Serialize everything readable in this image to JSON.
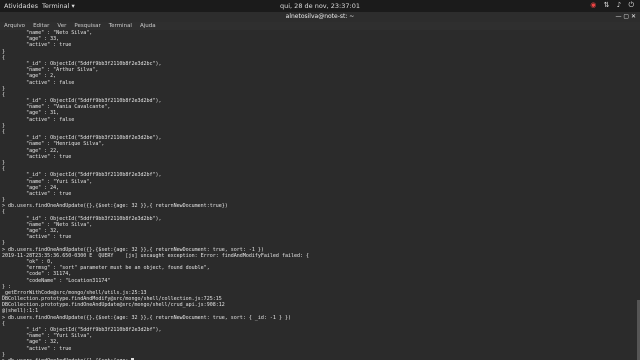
{
  "topbar": {
    "activities": "Atividades",
    "app": "Terminal ▾",
    "clock": "qui, 28 de nov, 23:37:01",
    "tray_icons": [
      "chrome-icon",
      "network-icon",
      "volume-icon",
      "power-icon"
    ]
  },
  "window": {
    "title": "alnetosilva@note-st: ~",
    "controls": "— ▢ ✕"
  },
  "menu": [
    "Arquivo",
    "Editar",
    "Ver",
    "Pesquisar",
    "Terminal",
    "Ajuda"
  ],
  "terminal_lines": [
    "        \"name\" : \"Neto Silva\",",
    "        \"age\" : 33,",
    "        \"active\" : true",
    "}",
    "{",
    "        \"_id\" : ObjectId(\"5ddff9bb3f2110b8f2e3d2bc\"),",
    "        \"name\" : \"Arthur Silva\",",
    "        \"age\" : 2,",
    "        \"active\" : false",
    "}",
    "{",
    "        \"_id\" : ObjectId(\"5ddff9bb3f2110b8f2e3d2bd\"),",
    "        \"name\" : \"Vania Cavalcante\",",
    "        \"age\" : 31,",
    "        \"active\" : false",
    "}",
    "{",
    "        \"_id\" : ObjectId(\"5ddff9bb3f2110b8f2e3d2be\"),",
    "        \"name\" : \"Henrique Silva\",",
    "        \"age\" : 22,",
    "        \"active\" : true",
    "}",
    "{",
    "        \"_id\" : ObjectId(\"5ddff9bb3f2110b8f2e3d2bf\"),",
    "        \"name\" : \"Yuri Silva\",",
    "        \"age\" : 24,",
    "        \"active\" : true",
    "}",
    "> db.users.findOneAndUpdate({},{$set:{age: 32 }},{ returnNewDocument:true})",
    "{",
    "        \"_id\" : ObjectId(\"5ddff9bb3f2110b8f2e3d2bb\"),",
    "        \"name\" : \"Neto Silva\",",
    "        \"age\" : 32,",
    "        \"active\" : true",
    "}",
    "> db.users.findOneAndUpdate({},{$set:{age: 32 }},{ returnNewDocument: true, sort: -1 })",
    "2019-11-28T23:35:36.650-0300 E  QUERY    [js] uncaught exception: Error: findAndModifyFailed failed: {",
    "        \"ok\" : 0,",
    "        \"errmsg\" : \"sort\" parameter must be an object, found double\",",
    "        \"code\" : 31174,",
    "        \"codeName\" : \"Location31174\"",
    "} :",
    "_getErrorWithCode@src/mongo/shell/utils.js:25:13",
    "DBCollection.prototype.findAndModify@src/mongo/shell/collection.js:725:15",
    "DBCollection.prototype.findOneAndUpdate@src/mongo/shell/crud_api.js:908:12",
    "@(shell):1:1",
    "> db.users.findOneAndUpdate({},{$set:{age: 32 }},{ returnNewDocument: true, sort: { _id: -1 } })",
    "{",
    "        \"_id\" : ObjectId(\"5ddff9bb3f2110b8f2e3d2bf\"),",
    "        \"name\" : \"Yuri Silva\",",
    "        \"age\" : 32,",
    "        \"active\" : true",
    "}",
    "> db.users.findOneAndUpdate({},{$set:{age: "
  ]
}
